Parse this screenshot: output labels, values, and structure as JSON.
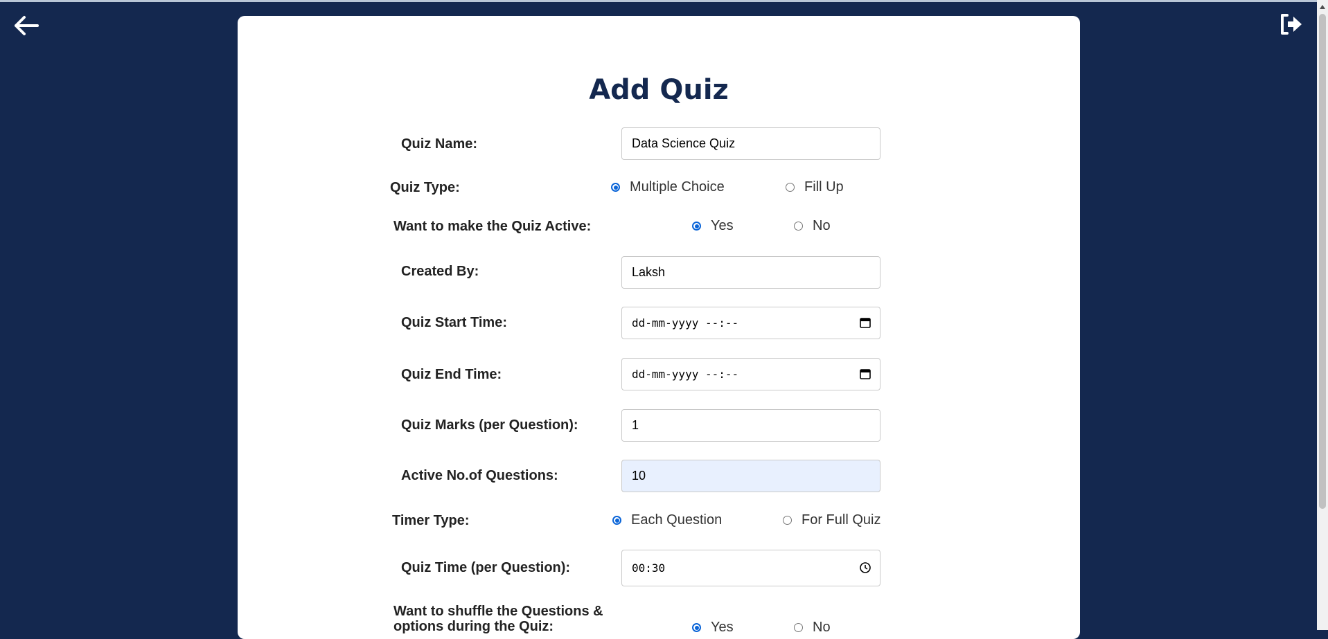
{
  "form": {
    "title": "Add Quiz",
    "quiz_name": {
      "label": "Quiz Name:",
      "value": "Data Science Quiz"
    },
    "quiz_type": {
      "label": "Quiz Type:",
      "options": [
        "Multiple Choice",
        "Fill Up"
      ],
      "selected": "Multiple Choice"
    },
    "active": {
      "label": "Want to make the Quiz Active:",
      "options": [
        "Yes",
        "No"
      ],
      "selected": "Yes"
    },
    "created_by": {
      "label": "Created By:",
      "value": "Laksh"
    },
    "start_time": {
      "label": "Quiz Start Time:",
      "value": "dd-mm-yyyy --:--"
    },
    "end_time": {
      "label": "Quiz End Time:",
      "value": "dd-mm-yyyy --:--"
    },
    "marks": {
      "label": "Quiz Marks (per Question):",
      "value": "1"
    },
    "active_questions": {
      "label": "Active No.of Questions:",
      "value": "10"
    },
    "timer_type": {
      "label": "Timer Type:",
      "options": [
        "Each Question",
        "For Full Quiz"
      ],
      "selected": "Each Question"
    },
    "quiz_time": {
      "label": "Quiz Time (per Question):",
      "value": "00:30"
    },
    "shuffle": {
      "label": "Want to shuffle the Questions & options during the Quiz:",
      "options": [
        "Yes",
        "No"
      ],
      "selected": "Yes"
    }
  },
  "icons": {
    "back": "arrow-left-icon",
    "logout": "sign-out-icon",
    "calendar": "calendar-icon",
    "clock": "clock-icon"
  },
  "colors": {
    "background": "#14284f",
    "title": "#14284f",
    "radio_accent": "#0b65d8",
    "autofill": "#e8f0fe"
  }
}
